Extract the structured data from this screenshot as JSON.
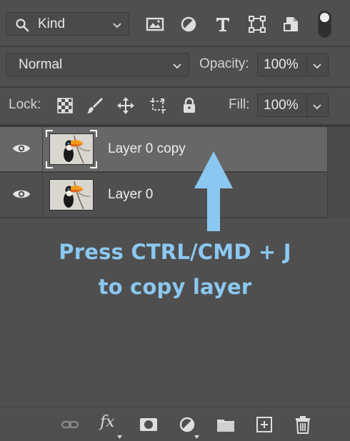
{
  "filter_bar": {
    "kind_label": "Kind",
    "filter_icons": [
      "image-filter-icon",
      "adjustment-filter-icon",
      "type-filter-icon",
      "shape-filter-icon",
      "smart-object-filter-icon"
    ]
  },
  "blend": {
    "mode": "Normal",
    "opacity_label": "Opacity:",
    "opacity_value": "100%"
  },
  "lock": {
    "label": "Lock:",
    "icons": [
      "lock-transparent-pixels-icon",
      "lock-image-pixels-icon",
      "lock-position-icon",
      "lock-artboard-icon",
      "lock-all-icon"
    ],
    "fill_label": "Fill:",
    "fill_value": "100%"
  },
  "layers": [
    {
      "name": "Layer 0 copy",
      "visible": true,
      "selected": true
    },
    {
      "name": "Layer 0",
      "visible": true,
      "selected": false
    }
  ],
  "annotation": {
    "line1": "Press CTRL/CMD + J",
    "line2": "to copy layer",
    "color": "#8bc8f1"
  },
  "bottom_bar": {
    "fx_label": "fx",
    "icons": [
      "link-layers-icon",
      "layer-style-icon",
      "add-mask-icon",
      "adjustment-layer-icon",
      "new-group-icon",
      "new-layer-icon",
      "delete-layer-icon"
    ]
  },
  "colors": {
    "panel_bg": "#4f4f4f",
    "selected_row": "#676767",
    "arrow": "#8bc8f1"
  }
}
